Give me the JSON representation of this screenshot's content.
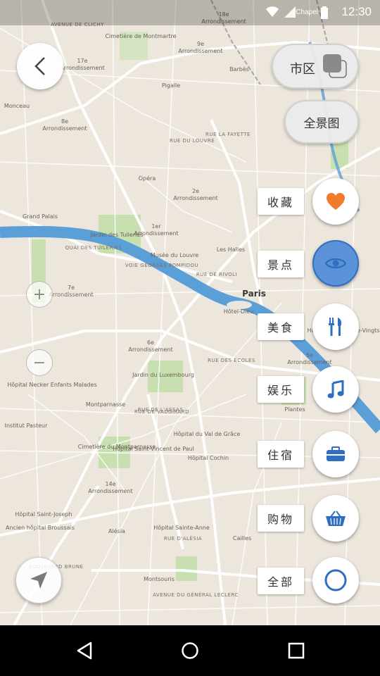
{
  "status_bar": {
    "carrier": "Chapel",
    "time": "12:30"
  },
  "map": {
    "labels": [
      {
        "text": "Paris",
        "cls": "big"
      },
      {
        "text": "17e",
        "cls": ""
      },
      {
        "text": "Arrondissement",
        "cls": ""
      },
      {
        "text": "18e",
        "cls": ""
      },
      {
        "text": "Arrondissement",
        "cls": ""
      },
      {
        "text": "8e",
        "cls": ""
      },
      {
        "text": "Arrondissement",
        "cls": ""
      },
      {
        "text": "9e",
        "cls": ""
      },
      {
        "text": "Arrondissement",
        "cls": ""
      },
      {
        "text": "2e",
        "cls": ""
      },
      {
        "text": "Arrondissement",
        "cls": ""
      },
      {
        "text": "1er",
        "cls": ""
      },
      {
        "text": "Arrondissement",
        "cls": ""
      },
      {
        "text": "7e",
        "cls": ""
      },
      {
        "text": "Arrondissement",
        "cls": ""
      },
      {
        "text": "6e",
        "cls": ""
      },
      {
        "text": "Arrondissement",
        "cls": ""
      },
      {
        "text": "5e",
        "cls": ""
      },
      {
        "text": "Arrondissement",
        "cls": ""
      },
      {
        "text": "14e",
        "cls": ""
      },
      {
        "text": "Arrondissement",
        "cls": ""
      },
      {
        "text": "Opéra",
        "cls": ""
      },
      {
        "text": "Pigalle",
        "cls": ""
      },
      {
        "text": "Barbès",
        "cls": ""
      },
      {
        "text": "Cimetière de Montmartre",
        "cls": ""
      },
      {
        "text": "Monceau",
        "cls": ""
      },
      {
        "text": "Grand Palais",
        "cls": ""
      },
      {
        "text": "Jardin des Tuileries",
        "cls": ""
      },
      {
        "text": "Musée du Louvre",
        "cls": ""
      },
      {
        "text": "Les Halles",
        "cls": ""
      },
      {
        "text": "Hôtel-Dieu",
        "cls": ""
      },
      {
        "text": "Jardin du Luxembourg",
        "cls": ""
      },
      {
        "text": "Montparnasse",
        "cls": ""
      },
      {
        "text": "Institut Pasteur",
        "cls": ""
      },
      {
        "text": "Hôpital Necker Enfants Malades",
        "cls": ""
      },
      {
        "text": "Cimetière du Montparnasse",
        "cls": ""
      },
      {
        "text": "Hôpital Saint-Vincent de Paul",
        "cls": ""
      },
      {
        "text": "Hôpital du Val de Grâce",
        "cls": ""
      },
      {
        "text": "Hôpital Cochin",
        "cls": ""
      },
      {
        "text": "Alésia",
        "cls": ""
      },
      {
        "text": "Montsouris",
        "cls": ""
      },
      {
        "text": "Hôpital Sainte-Anne",
        "cls": ""
      },
      {
        "text": "Hôpital Saint-Joseph",
        "cls": ""
      },
      {
        "text": "Ancien hôpital Broussais",
        "cls": ""
      },
      {
        "text": "Hôpital des Quinze-Vingts",
        "cls": ""
      },
      {
        "text": "Plantes",
        "cls": ""
      },
      {
        "text": "Cailles",
        "cls": ""
      },
      {
        "text": "RUE LA FAYETTE",
        "cls": "road"
      },
      {
        "text": "RUE DU LOUVRE",
        "cls": "road"
      },
      {
        "text": "VOIE GEORGES POMPIDOU",
        "cls": "road"
      },
      {
        "text": "RUE DE RIVOLI",
        "cls": "road"
      },
      {
        "text": "QUAI DES TUILERIES",
        "cls": "road"
      },
      {
        "text": "RUE DES ÉCOLES",
        "cls": "road"
      },
      {
        "text": "RUE DE VAUGIRARD",
        "cls": "road"
      },
      {
        "text": "BOULEVARD BRUNE",
        "cls": "road"
      },
      {
        "text": "AVENUE DU GÉNÉRAL LECLERC",
        "cls": "road"
      },
      {
        "text": "AVENUE DE CLICHY",
        "cls": "road"
      },
      {
        "text": "RUE DE L'ASSAS",
        "cls": "road"
      },
      {
        "text": "RUE D'ALÉSIA",
        "cls": "road"
      }
    ]
  },
  "controls": {
    "toggle_label": "市区",
    "panorama_label": "全景图",
    "zoom_in": "+",
    "zoom_out": "−"
  },
  "categories": [
    {
      "label": "收藏",
      "icon": "heart-icon",
      "color": "#f07b2a",
      "active": false
    },
    {
      "label": "景点",
      "icon": "eye-icon",
      "color": "#2f6fc2",
      "active": true
    },
    {
      "label": "美食",
      "icon": "fork-knife-icon",
      "color": "#2f6fc2",
      "active": false
    },
    {
      "label": "娱乐",
      "icon": "music-note-icon",
      "color": "#2f6fc2",
      "active": false
    },
    {
      "label": "住宿",
      "icon": "suitcase-icon",
      "color": "#2f6fc2",
      "active": false
    },
    {
      "label": "购物",
      "icon": "basket-icon",
      "color": "#2f6fc2",
      "active": false
    },
    {
      "label": "全部",
      "icon": "circle-icon",
      "color": "#2f6fc2",
      "active": false
    }
  ],
  "colors": {
    "river": "#5b9fd9",
    "park": "#c8dfb0",
    "accent": "#2f6fc2",
    "favorite": "#f07b2a"
  }
}
